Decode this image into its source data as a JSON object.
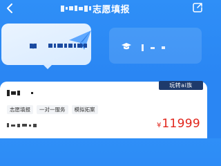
{
  "header": {
    "back_icon": "chevron-left-icon",
    "title": "志愿填报",
    "share_icon": "share-icon"
  },
  "cards": {
    "left": {
      "icon": "book-icon",
      "decoration": "paper-plane-icon"
    },
    "right": {
      "icon": "graduation-cap-icon"
    }
  },
  "panel": {
    "badge": "玩转ai族",
    "tags": [
      "志愿填报",
      "一对一服务",
      "模拟拓案"
    ],
    "price_symbol": "¥",
    "price_value": "11999"
  },
  "colors": {
    "background": "#2a86f3",
    "price": "#e1251b",
    "badge": "#1e3a6b"
  }
}
